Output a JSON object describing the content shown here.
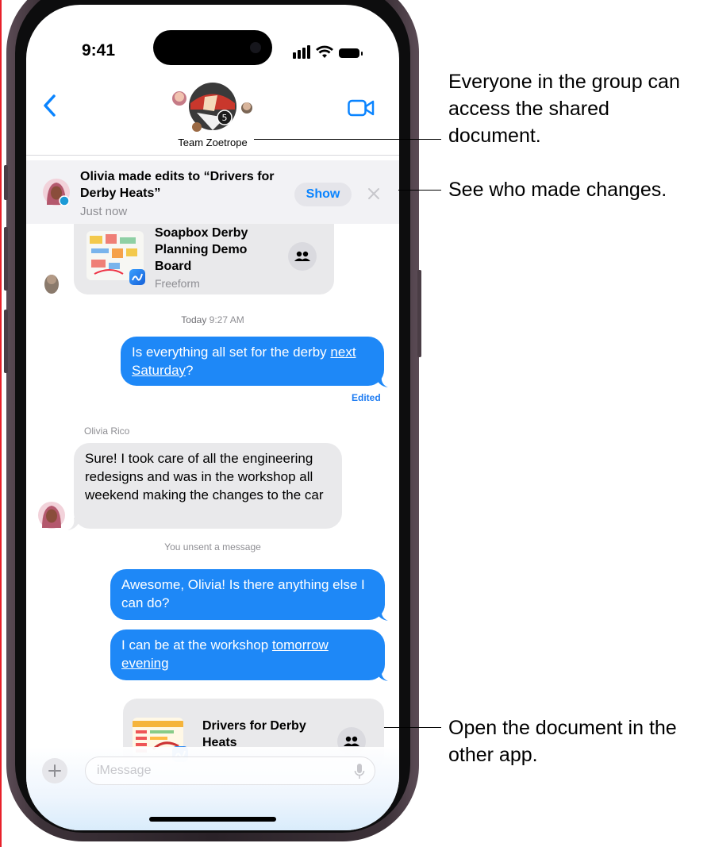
{
  "status_bar": {
    "time": "9:41"
  },
  "header": {
    "group_name": "Team Zoetrope",
    "avatar_badge": "5"
  },
  "banner": {
    "title": "Olivia made edits to “Drivers for Derby Heats”",
    "time": "Just now",
    "show_label": "Show"
  },
  "cards": [
    {
      "title": "Soapbox Derby Planning Demo Board",
      "subtitle": "Freeform"
    },
    {
      "title": "Drivers for Derby Heats"
    }
  ],
  "thread": {
    "timestamp_day": "Today",
    "timestamp_time": "9:27 AM",
    "msg1_text": "Is everything all set for the derby ",
    "msg1_link": "next Saturday",
    "msg1_end": "?",
    "edited_label": "Edited",
    "sender_name": "Olivia Rico",
    "reply_text": "Sure! I took care of all the engineering redesigns and was in the workshop all weekend making the changes to the car",
    "unsent_notice": "You unsent a message",
    "msg2_text": "Awesome, Olivia! Is there anything else I can do?",
    "msg3_text": "I can be at the workshop ",
    "msg3_link": "tomorrow evening"
  },
  "composer": {
    "placeholder": "iMessage"
  },
  "callouts": [
    "Everyone in the group can access the shared document.",
    "See who made changes.",
    "Open the document in the other app."
  ],
  "colors": {
    "imessage_blue": "#1e88f7",
    "link_blue": "#0a84ff",
    "incoming_gray": "#e9e9eb"
  }
}
